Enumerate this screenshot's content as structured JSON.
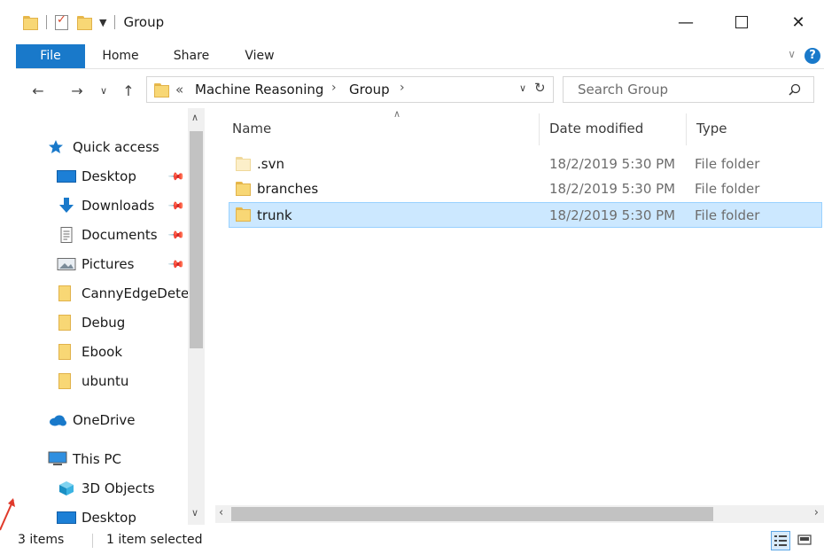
{
  "window": {
    "title": "Group"
  },
  "ribbon": {
    "tabs": [
      "File",
      "Home",
      "Share",
      "View"
    ]
  },
  "address": {
    "overflow": "«",
    "crumbs": [
      "Machine Reasoning",
      "Group"
    ],
    "search_placeholder": "Search Group"
  },
  "navpane": {
    "items": [
      {
        "label": "Quick access",
        "icon": "star-icon"
      },
      {
        "label": "Desktop",
        "icon": "desktop-icon",
        "pinned": true
      },
      {
        "label": "Downloads",
        "icon": "download-arrow-icon",
        "pinned": true
      },
      {
        "label": "Documents",
        "icon": "documents-icon",
        "pinned": true
      },
      {
        "label": "Pictures",
        "icon": "pictures-icon",
        "pinned": true
      },
      {
        "label": "CannyEdgeDete",
        "icon": "folder-icon"
      },
      {
        "label": "Debug",
        "icon": "folder-icon"
      },
      {
        "label": "Ebook",
        "icon": "folder-icon"
      },
      {
        "label": "ubuntu",
        "icon": "folder-icon"
      },
      {
        "label": "OneDrive",
        "icon": "cloud-icon"
      },
      {
        "label": "This PC",
        "icon": "computer-icon"
      },
      {
        "label": "3D Objects",
        "icon": "cube-icon"
      },
      {
        "label": "Desktop",
        "icon": "desktop-icon"
      }
    ]
  },
  "files": {
    "columns": [
      "Name",
      "Date modified",
      "Type"
    ],
    "rows": [
      {
        "name": ".svn",
        "date": "18/2/2019 5:30 PM",
        "type": "File folder",
        "hidden": true,
        "selected": false
      },
      {
        "name": "branches",
        "date": "18/2/2019 5:30 PM",
        "type": "File folder",
        "hidden": false,
        "selected": false
      },
      {
        "name": "trunk",
        "date": "18/2/2019 5:30 PM",
        "type": "File folder",
        "hidden": false,
        "selected": true
      }
    ]
  },
  "status": {
    "count": "3 items",
    "selection": "1 item selected"
  },
  "colors": {
    "accent": "#1979ca",
    "selection_bg": "#cce8ff",
    "selection_border": "#99d1ff",
    "folder": "#f8d775"
  }
}
